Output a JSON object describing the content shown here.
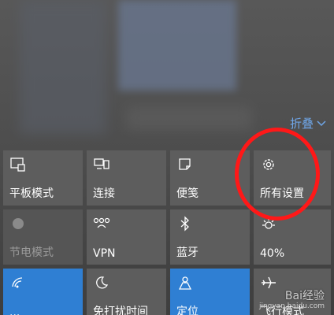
{
  "action_center": {
    "collapse_label": "折叠",
    "tiles": [
      {
        "label": "平板模式",
        "icon": "tablet-mode-icon",
        "state": "off"
      },
      {
        "label": "连接",
        "icon": "connect-icon",
        "state": "off"
      },
      {
        "label": "便笺",
        "icon": "note-icon",
        "state": "off"
      },
      {
        "label": "所有设置",
        "icon": "gear-icon",
        "state": "off"
      },
      {
        "label": "节电模式",
        "icon": "battery-saver-icon",
        "state": "disabled"
      },
      {
        "label": "VPN",
        "icon": "vpn-icon",
        "state": "off"
      },
      {
        "label": "蓝牙",
        "icon": "bluetooth-icon",
        "state": "off"
      },
      {
        "label": "40%",
        "icon": "brightness-icon",
        "state": "off"
      },
      {
        "label": "...",
        "icon": "wifi-icon",
        "state": "on"
      },
      {
        "label": "免打扰时间",
        "icon": "moon-icon",
        "state": "off"
      },
      {
        "label": "定位",
        "icon": "location-icon",
        "state": "on"
      },
      {
        "label": "飞行模式",
        "icon": "airplane-icon",
        "state": "off"
      }
    ]
  },
  "annotation": {
    "color": "#ff1818"
  },
  "watermark": {
    "text": "Bai经验",
    "sub": "jingyan.baidu.com"
  },
  "colors": {
    "tile": "#5d5d5d",
    "tile_on": "#2f7fd3",
    "accent_text": "#6fa6e8"
  }
}
